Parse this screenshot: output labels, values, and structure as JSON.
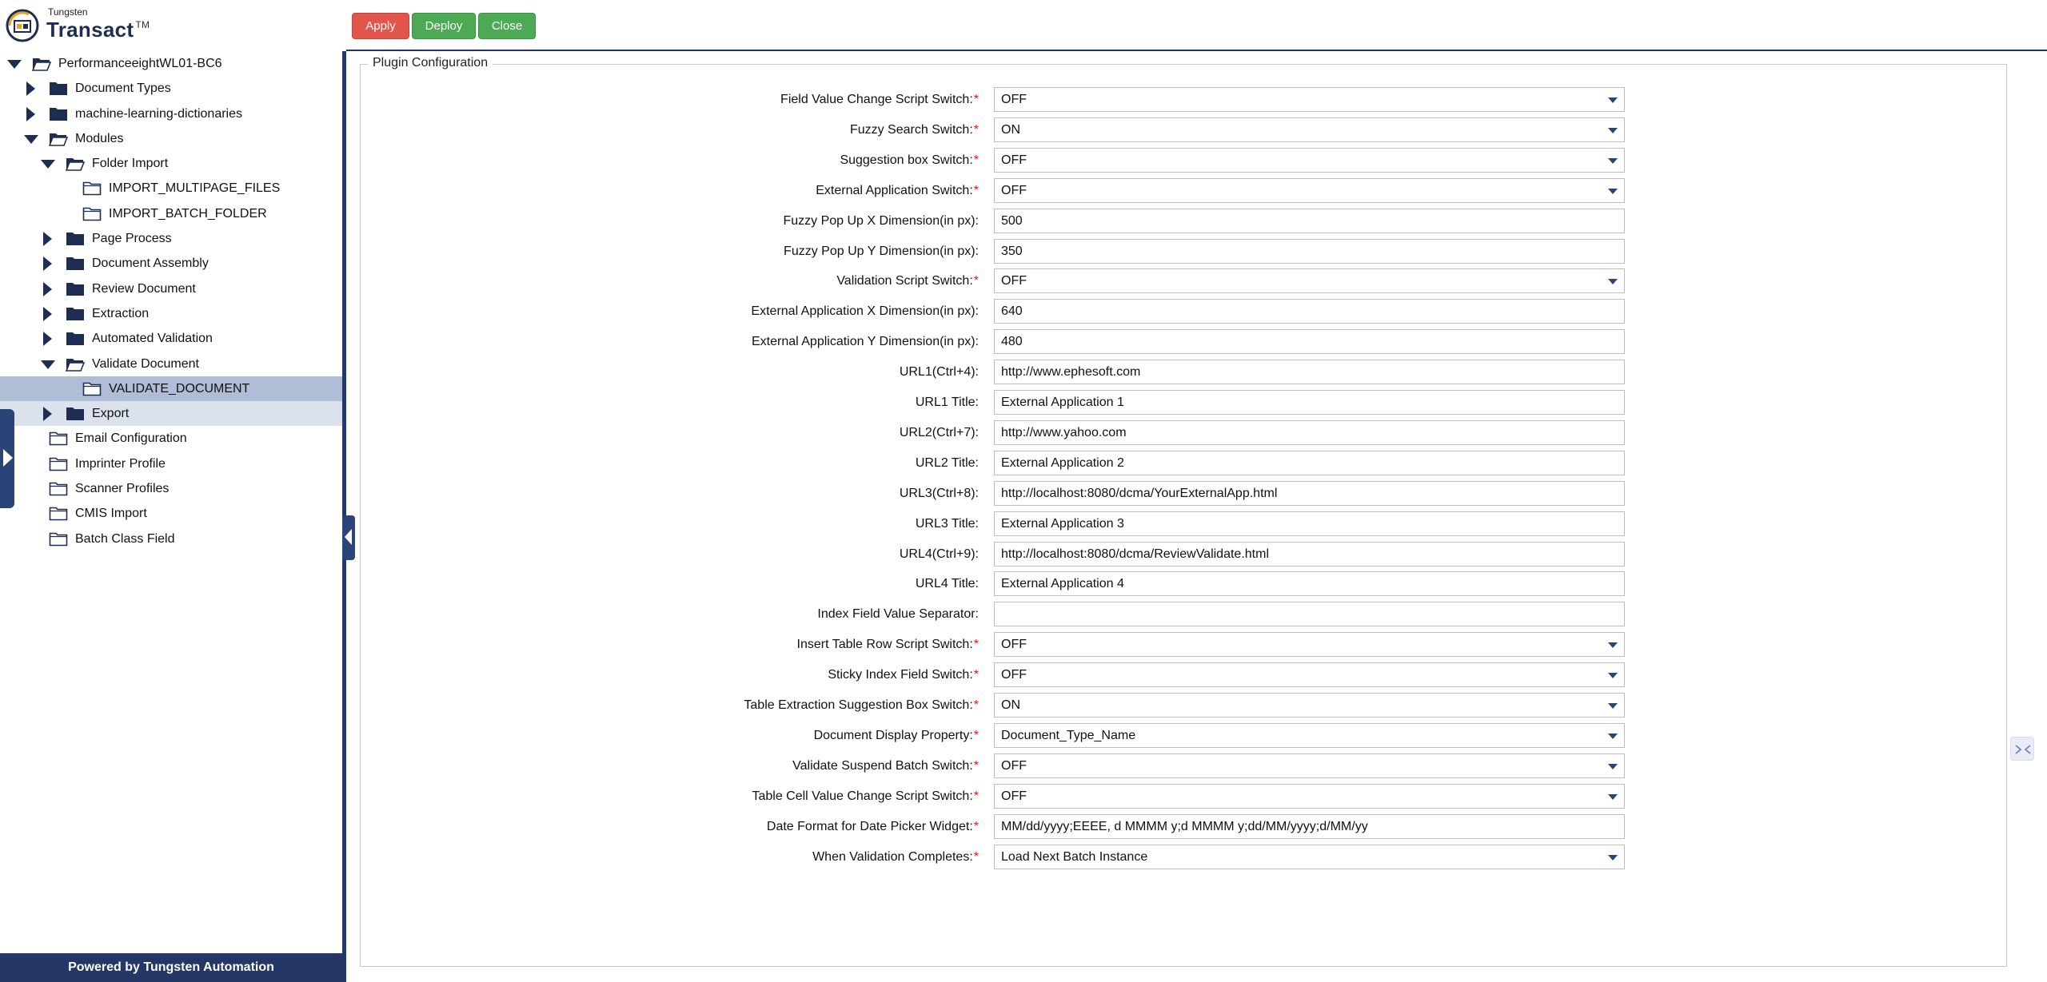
{
  "app": {
    "brand_small": "Tungsten",
    "brand_name": "Transact",
    "brand_tm": "TM",
    "footer": "Powered by Tungsten Automation"
  },
  "toolbar": {
    "apply_label": "Apply",
    "deploy_label": "Deploy",
    "close_label": "Close"
  },
  "tree": [
    {
      "label": "PerformanceeightWL01-BC6",
      "level": 0,
      "toggle": "open",
      "folder": "open",
      "state": ""
    },
    {
      "label": "Document Types",
      "level": 1,
      "toggle": "closed",
      "folder": "filled",
      "state": ""
    },
    {
      "label": "machine-learning-dictionaries",
      "level": 1,
      "toggle": "closed",
      "folder": "filled",
      "state": ""
    },
    {
      "label": "Modules",
      "level": 1,
      "toggle": "open",
      "folder": "open",
      "state": ""
    },
    {
      "label": "Folder Import",
      "level": 2,
      "toggle": "open",
      "folder": "open",
      "state": ""
    },
    {
      "label": "IMPORT_MULTIPAGE_FILES",
      "level": 3,
      "toggle": "none",
      "folder": "outline",
      "state": ""
    },
    {
      "label": "IMPORT_BATCH_FOLDER",
      "level": 3,
      "toggle": "none",
      "folder": "outline",
      "state": ""
    },
    {
      "label": "Page Process",
      "level": 2,
      "toggle": "closed",
      "folder": "filled",
      "state": ""
    },
    {
      "label": "Document Assembly",
      "level": 2,
      "toggle": "closed",
      "folder": "filled",
      "state": ""
    },
    {
      "label": "Review Document",
      "level": 2,
      "toggle": "closed",
      "folder": "filled",
      "state": ""
    },
    {
      "label": "Extraction",
      "level": 2,
      "toggle": "closed",
      "folder": "filled",
      "state": ""
    },
    {
      "label": "Automated Validation",
      "level": 2,
      "toggle": "closed",
      "folder": "filled",
      "state": ""
    },
    {
      "label": "Validate Document",
      "level": 2,
      "toggle": "open",
      "folder": "open",
      "state": ""
    },
    {
      "label": "VALIDATE_DOCUMENT",
      "level": 3,
      "toggle": "none",
      "folder": "outline",
      "state": "selected"
    },
    {
      "label": "Export",
      "level": 2,
      "toggle": "closed",
      "folder": "filled",
      "state": "hovered"
    },
    {
      "label": "Email Configuration",
      "level": 1,
      "toggle": "none",
      "folder": "outline",
      "state": ""
    },
    {
      "label": "Imprinter Profile",
      "level": 1,
      "toggle": "none",
      "folder": "outline",
      "state": ""
    },
    {
      "label": "Scanner Profiles",
      "level": 1,
      "toggle": "none",
      "folder": "outline",
      "state": ""
    },
    {
      "label": "CMIS Import",
      "level": 1,
      "toggle": "none",
      "folder": "outline",
      "state": ""
    },
    {
      "label": "Batch Class Field",
      "level": 1,
      "toggle": "none",
      "folder": "outline",
      "state": ""
    }
  ],
  "config": {
    "legend": "Plugin Configuration",
    "fields": [
      {
        "label": "Field Value Change Script Switch:",
        "required": true,
        "type": "select",
        "value": "OFF"
      },
      {
        "label": "Fuzzy Search Switch:",
        "required": true,
        "type": "select",
        "value": "ON"
      },
      {
        "label": "Suggestion box Switch:",
        "required": true,
        "type": "select",
        "value": "OFF"
      },
      {
        "label": "External Application Switch:",
        "required": true,
        "type": "select",
        "value": "OFF"
      },
      {
        "label": "Fuzzy Pop Up X Dimension(in px):",
        "required": false,
        "type": "text",
        "value": "500"
      },
      {
        "label": "Fuzzy Pop Up Y Dimension(in px):",
        "required": false,
        "type": "text",
        "value": "350"
      },
      {
        "label": "Validation Script Switch:",
        "required": true,
        "type": "select",
        "value": "OFF"
      },
      {
        "label": "External Application X Dimension(in px):",
        "required": false,
        "type": "text",
        "value": "640"
      },
      {
        "label": "External Application Y Dimension(in px):",
        "required": false,
        "type": "text",
        "value": "480"
      },
      {
        "label": "URL1(Ctrl+4):",
        "required": false,
        "type": "text",
        "value": "http://www.ephesoft.com"
      },
      {
        "label": "URL1 Title:",
        "required": false,
        "type": "text",
        "value": "External Application 1"
      },
      {
        "label": "URL2(Ctrl+7):",
        "required": false,
        "type": "text",
        "value": "http://www.yahoo.com"
      },
      {
        "label": "URL2 Title:",
        "required": false,
        "type": "text",
        "value": "External Application 2"
      },
      {
        "label": "URL3(Ctrl+8):",
        "required": false,
        "type": "text",
        "value": "http://localhost:8080/dcma/YourExternalApp.html"
      },
      {
        "label": "URL3 Title:",
        "required": false,
        "type": "text",
        "value": "External Application 3"
      },
      {
        "label": "URL4(Ctrl+9):",
        "required": false,
        "type": "text",
        "value": "http://localhost:8080/dcma/ReviewValidate.html"
      },
      {
        "label": "URL4 Title:",
        "required": false,
        "type": "text",
        "value": "External Application 4"
      },
      {
        "label": "Index Field Value Separator:",
        "required": false,
        "type": "text",
        "value": ""
      },
      {
        "label": "Insert Table Row Script Switch:",
        "required": true,
        "type": "select",
        "value": "OFF"
      },
      {
        "label": "Sticky Index Field Switch:",
        "required": true,
        "type": "select",
        "value": "OFF"
      },
      {
        "label": "Table Extraction Suggestion Box Switch:",
        "required": true,
        "type": "select",
        "value": "ON"
      },
      {
        "label": "Document Display Property:",
        "required": true,
        "type": "select",
        "value": "Document_Type_Name"
      },
      {
        "label": "Validate Suspend Batch Switch:",
        "required": true,
        "type": "select",
        "value": "OFF"
      },
      {
        "label": "Table Cell Value Change Script Switch:",
        "required": true,
        "type": "select",
        "value": "OFF"
      },
      {
        "label": "Date Format for Date Picker Widget:",
        "required": true,
        "type": "text",
        "value": "MM/dd/yyyy;EEEE, d MMMM y;d MMMM y;dd/MM/yyyy;d/MM/yy"
      },
      {
        "label": "When Validation Completes:",
        "required": true,
        "type": "select",
        "value": "Load Next Batch Instance"
      }
    ]
  },
  "colors": {
    "navy": "#253766",
    "apply": "#e2554c",
    "deploy": "#4caa54",
    "required": "#e01919",
    "selected_row": "#b0bdd6"
  }
}
